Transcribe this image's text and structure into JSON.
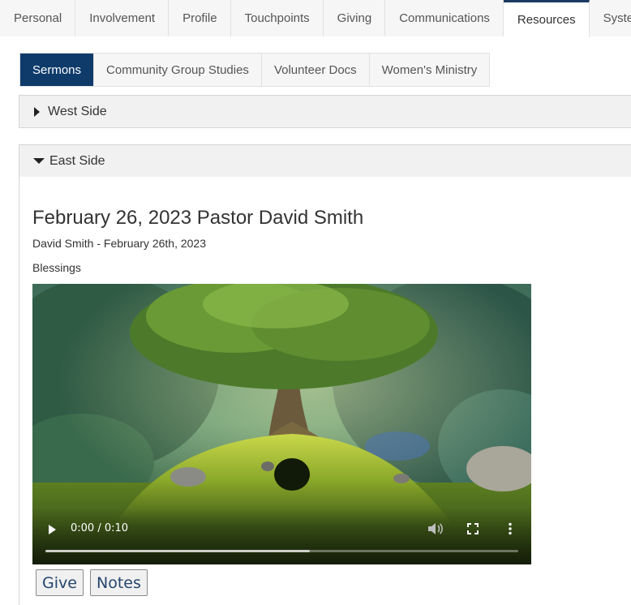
{
  "top_tabs": [
    {
      "label": "Personal"
    },
    {
      "label": "Involvement"
    },
    {
      "label": "Profile"
    },
    {
      "label": "Touchpoints"
    },
    {
      "label": "Giving"
    },
    {
      "label": "Communications"
    },
    {
      "label": "Resources",
      "active": true
    },
    {
      "label": "System"
    }
  ],
  "sub_tabs": [
    {
      "label": "Sermons",
      "active": true
    },
    {
      "label": "Community Group Studies"
    },
    {
      "label": "Volunteer Docs"
    },
    {
      "label": "Women's Ministry"
    }
  ],
  "sections": {
    "west": {
      "label": "West Side",
      "expanded": false
    },
    "east": {
      "label": "East Side",
      "expanded": true
    }
  },
  "sermon": {
    "title": "February 26, 2023 Pastor David Smith",
    "meta": "David Smith - February 26th, 2023",
    "description": "Blessings",
    "video": {
      "time": "0:00 / 0:10",
      "buffered_fraction": 0.56
    },
    "buttons": {
      "give": "Give",
      "notes": "Notes"
    }
  },
  "colors": {
    "accent": "#0f3b6b",
    "button_text": "#24456e"
  }
}
